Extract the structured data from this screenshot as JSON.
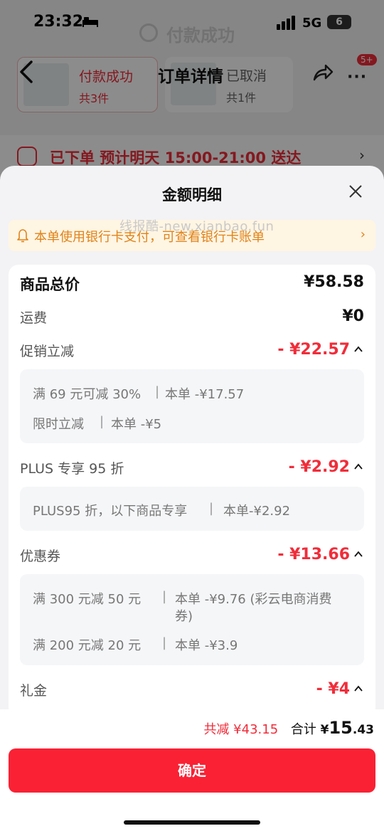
{
  "status_bar": {
    "time": "23:32",
    "network": "5G",
    "battery": "6"
  },
  "background": {
    "ghost_title": "付款成功",
    "nav_title": "订单详情",
    "badge": "5+",
    "packages": [
      {
        "status": "付款成功",
        "count": "共3件"
      },
      {
        "status": "已取消",
        "count": "共1件"
      }
    ],
    "order_status": "已下单 预计明天 15:00-21:00 送达"
  },
  "sheet": {
    "title": "金额明细",
    "watermark": "线报酷-new.xianbao.fun",
    "notice": "本单使用银行卡支付，可查看银行卡账单",
    "rows": {
      "goods_total": {
        "label": "商品总价",
        "value": "¥58.58"
      },
      "shipping": {
        "label": "运费",
        "value": "¥0"
      },
      "promo": {
        "label": "促销立减",
        "value": "- ¥22.57"
      },
      "plus": {
        "label": "PLUS 专享 95 折",
        "value": "- ¥2.92"
      },
      "coupon": {
        "label": "优惠券",
        "value": "- ¥13.66"
      },
      "gift": {
        "label": "礼金",
        "value": "- ¥4"
      }
    },
    "promo_details": [
      {
        "name": "满 69 元可减 30%",
        "amount": "本单 -¥17.57"
      },
      {
        "name": "限时立减",
        "amount": "本单 -¥5"
      }
    ],
    "plus_details": [
      {
        "name": "PLUS95 折，以下商品专享",
        "amount": "本单-¥2.92"
      }
    ],
    "coupon_details": [
      {
        "name": "满 300 元减 50 元",
        "amount": "本单 -¥9.76 (彩云电商消费",
        "amount2": "券)"
      },
      {
        "name": "满 200 元减 20 元",
        "amount": "本单 -¥3.9"
      }
    ]
  },
  "footer": {
    "total_reduced": "共减 ¥43.15",
    "total_label": "合计",
    "currency": "¥",
    "total_int": "15",
    "total_dec": ".43",
    "confirm_label": "确定"
  },
  "colors": {
    "accent": "#f02d3a",
    "button": "#fa2134",
    "notice_text": "#e08319",
    "notice_bg": "#fff5e3"
  }
}
